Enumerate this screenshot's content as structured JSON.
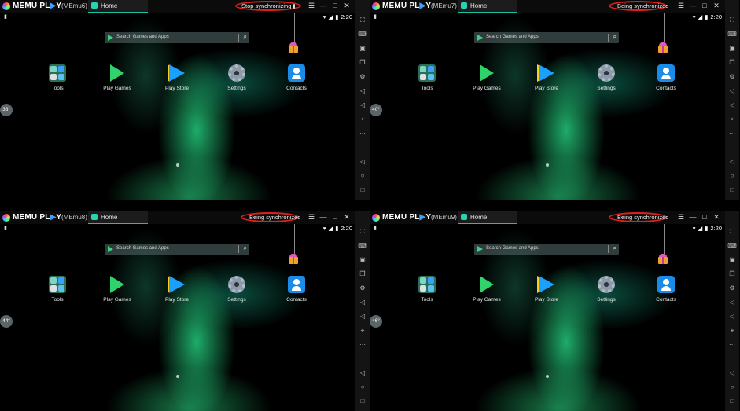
{
  "brand": {
    "part1": "MEMU PL",
    "part2": "▶",
    "part3": "Y"
  },
  "windows": [
    {
      "emu_name": "(MEmu6)",
      "tab_label": "Home",
      "sync_label": "Stop synchronizing",
      "sync_mode": "stop",
      "temperature": "33°",
      "time": "2:20"
    },
    {
      "emu_name": "(MEmu7)",
      "tab_label": "Home",
      "sync_label": "Being synchronized",
      "sync_mode": "being",
      "temperature": "40°",
      "time": "2:20"
    },
    {
      "emu_name": "(MEmu8)",
      "tab_label": "Home",
      "sync_label": "Being synchronized",
      "sync_mode": "being",
      "temperature": "44°",
      "time": "2:20"
    },
    {
      "emu_name": "(MEmu9)",
      "tab_label": "Home",
      "sync_label": "Being synchronized",
      "sync_mode": "being",
      "temperature": "46°",
      "time": "2:20"
    }
  ],
  "search": {
    "placeholder": "Search Games and Apps"
  },
  "apps": [
    {
      "label": "Tools",
      "icon": "tools-icon"
    },
    {
      "label": "Play Games",
      "icon": "play-games-icon"
    },
    {
      "label": "Play Store",
      "icon": "play-store-icon"
    },
    {
      "label": "Settings",
      "icon": "settings-icon"
    },
    {
      "label": "Contacts",
      "icon": "contacts-icon"
    }
  ],
  "titlebar_controls": [
    "menu-icon",
    "minimize-icon",
    "maximize-icon",
    "close-icon",
    "collapse-icon"
  ],
  "sidebar_icons": [
    "fullscreen-icon",
    "keyboard-icon",
    "apk-icon",
    "multi-window-icon",
    "settings-icon",
    "volume-down-icon",
    "volume-up-icon",
    "location-icon",
    "more-icon",
    "back-icon",
    "home-icon",
    "recents-icon",
    "menu-icon"
  ],
  "colors": {
    "accent": "#19c2a7",
    "highlight": "#e02020",
    "titlebar": "#0b0b0b"
  }
}
